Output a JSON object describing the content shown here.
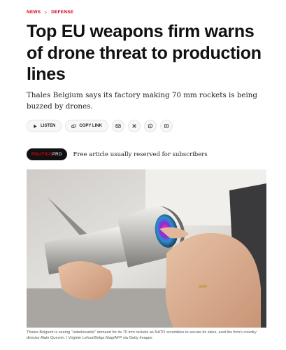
{
  "breadcrumb": {
    "section": "NEWS",
    "subsection": "DEFENSE"
  },
  "article": {
    "title": "Top EU weapons firm warns of drone threat to production lines",
    "subtitle": "Thales Belgium says its factory making 70 mm rockets is being buzzed by drones."
  },
  "toolbar": {
    "listen_label": "LISTEN",
    "copy_link_label": "COPY LINK",
    "icons": [
      "headphones-icon",
      "link-icon",
      "email-icon",
      "x-icon",
      "whatsapp-icon",
      "bookmark-icon"
    ]
  },
  "access": {
    "badge_politico": "POLITICO",
    "badge_pro": "PRO",
    "free_text": "Free article usually reserved for subscribers"
  },
  "photo": {
    "caption": "Thales Belgium is seeing \"unbelievable\" demand for its 70 mm rockets as NATO scrambles to secure its skies, said the firm's country director Alain Quevrin. | Virginie Lefour/Belga Mag/AFP via Getty Images"
  },
  "colors": {
    "accent": "#d0021b",
    "text": "#111111",
    "pill_bg": "#f7f7f7"
  }
}
